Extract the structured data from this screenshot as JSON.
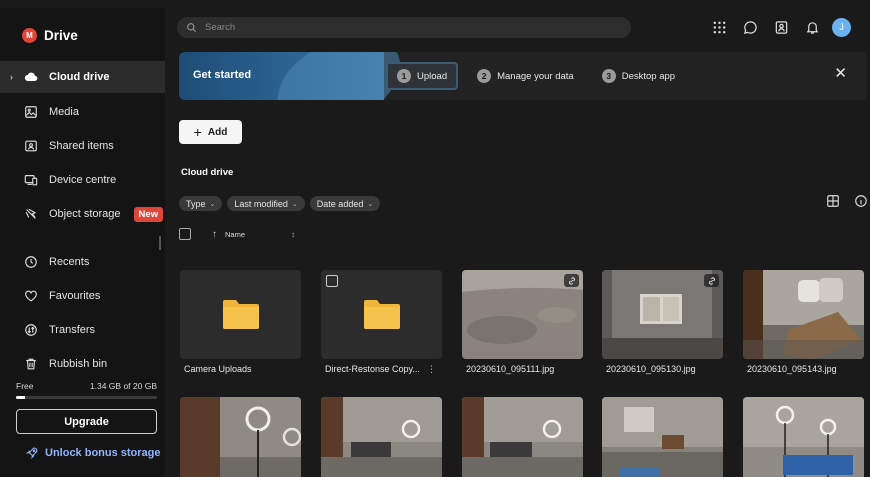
{
  "brand": {
    "logo_letter": "M",
    "name": "Drive"
  },
  "sidebar": {
    "items": [
      {
        "label": "Cloud drive",
        "icon": "cloud-icon",
        "active": true
      },
      {
        "label": "Media",
        "icon": "image-icon"
      },
      {
        "label": "Shared items",
        "icon": "shared-folder-icon"
      },
      {
        "label": "Device centre",
        "icon": "device-icon"
      },
      {
        "label": "Object storage",
        "icon": "object-storage-icon",
        "badge": "New"
      },
      {
        "label": "Recents",
        "icon": "clock-icon"
      },
      {
        "label": "Favourites",
        "icon": "heart-icon"
      },
      {
        "label": "Transfers",
        "icon": "transfers-icon"
      },
      {
        "label": "Rubbish bin",
        "icon": "trash-icon"
      }
    ],
    "storage": {
      "free_label": "Free",
      "usage": "1.34 GB of 20 GB",
      "used_fraction": 0.067
    },
    "upgrade_label": "Upgrade",
    "bonus_label": "Unlock bonus storage"
  },
  "topbar": {
    "search_placeholder": "Search",
    "icons": [
      "apps-grid-icon",
      "chat-icon",
      "contacts-icon",
      "bell-icon"
    ],
    "avatar_initial": "J"
  },
  "banner": {
    "title": "Get started",
    "steps": [
      {
        "num": "1",
        "label": "Upload"
      },
      {
        "num": "2",
        "label": "Manage your data"
      },
      {
        "num": "3",
        "label": "Desktop app"
      }
    ]
  },
  "toolbar": {
    "add_label": "Add"
  },
  "section_title": "Cloud drive",
  "filters": [
    "Type",
    "Last modified",
    "Date added"
  ],
  "sort": {
    "label": "Name"
  },
  "files": [
    {
      "name": "Camera Uploads",
      "kind": "folder"
    },
    {
      "name": "Direct-Restonse Copy...",
      "kind": "folder"
    },
    {
      "name": "20230610_095111.jpg",
      "kind": "image"
    },
    {
      "name": "20230610_095130.jpg",
      "kind": "image"
    },
    {
      "name": "20230610_095143.jpg",
      "kind": "image"
    }
  ],
  "colors": {
    "accent": "#e0453a",
    "link": "#8fb6ff",
    "folder": "#f0b43a",
    "sidebar": "#141414",
    "background": "#1a1a1a"
  }
}
